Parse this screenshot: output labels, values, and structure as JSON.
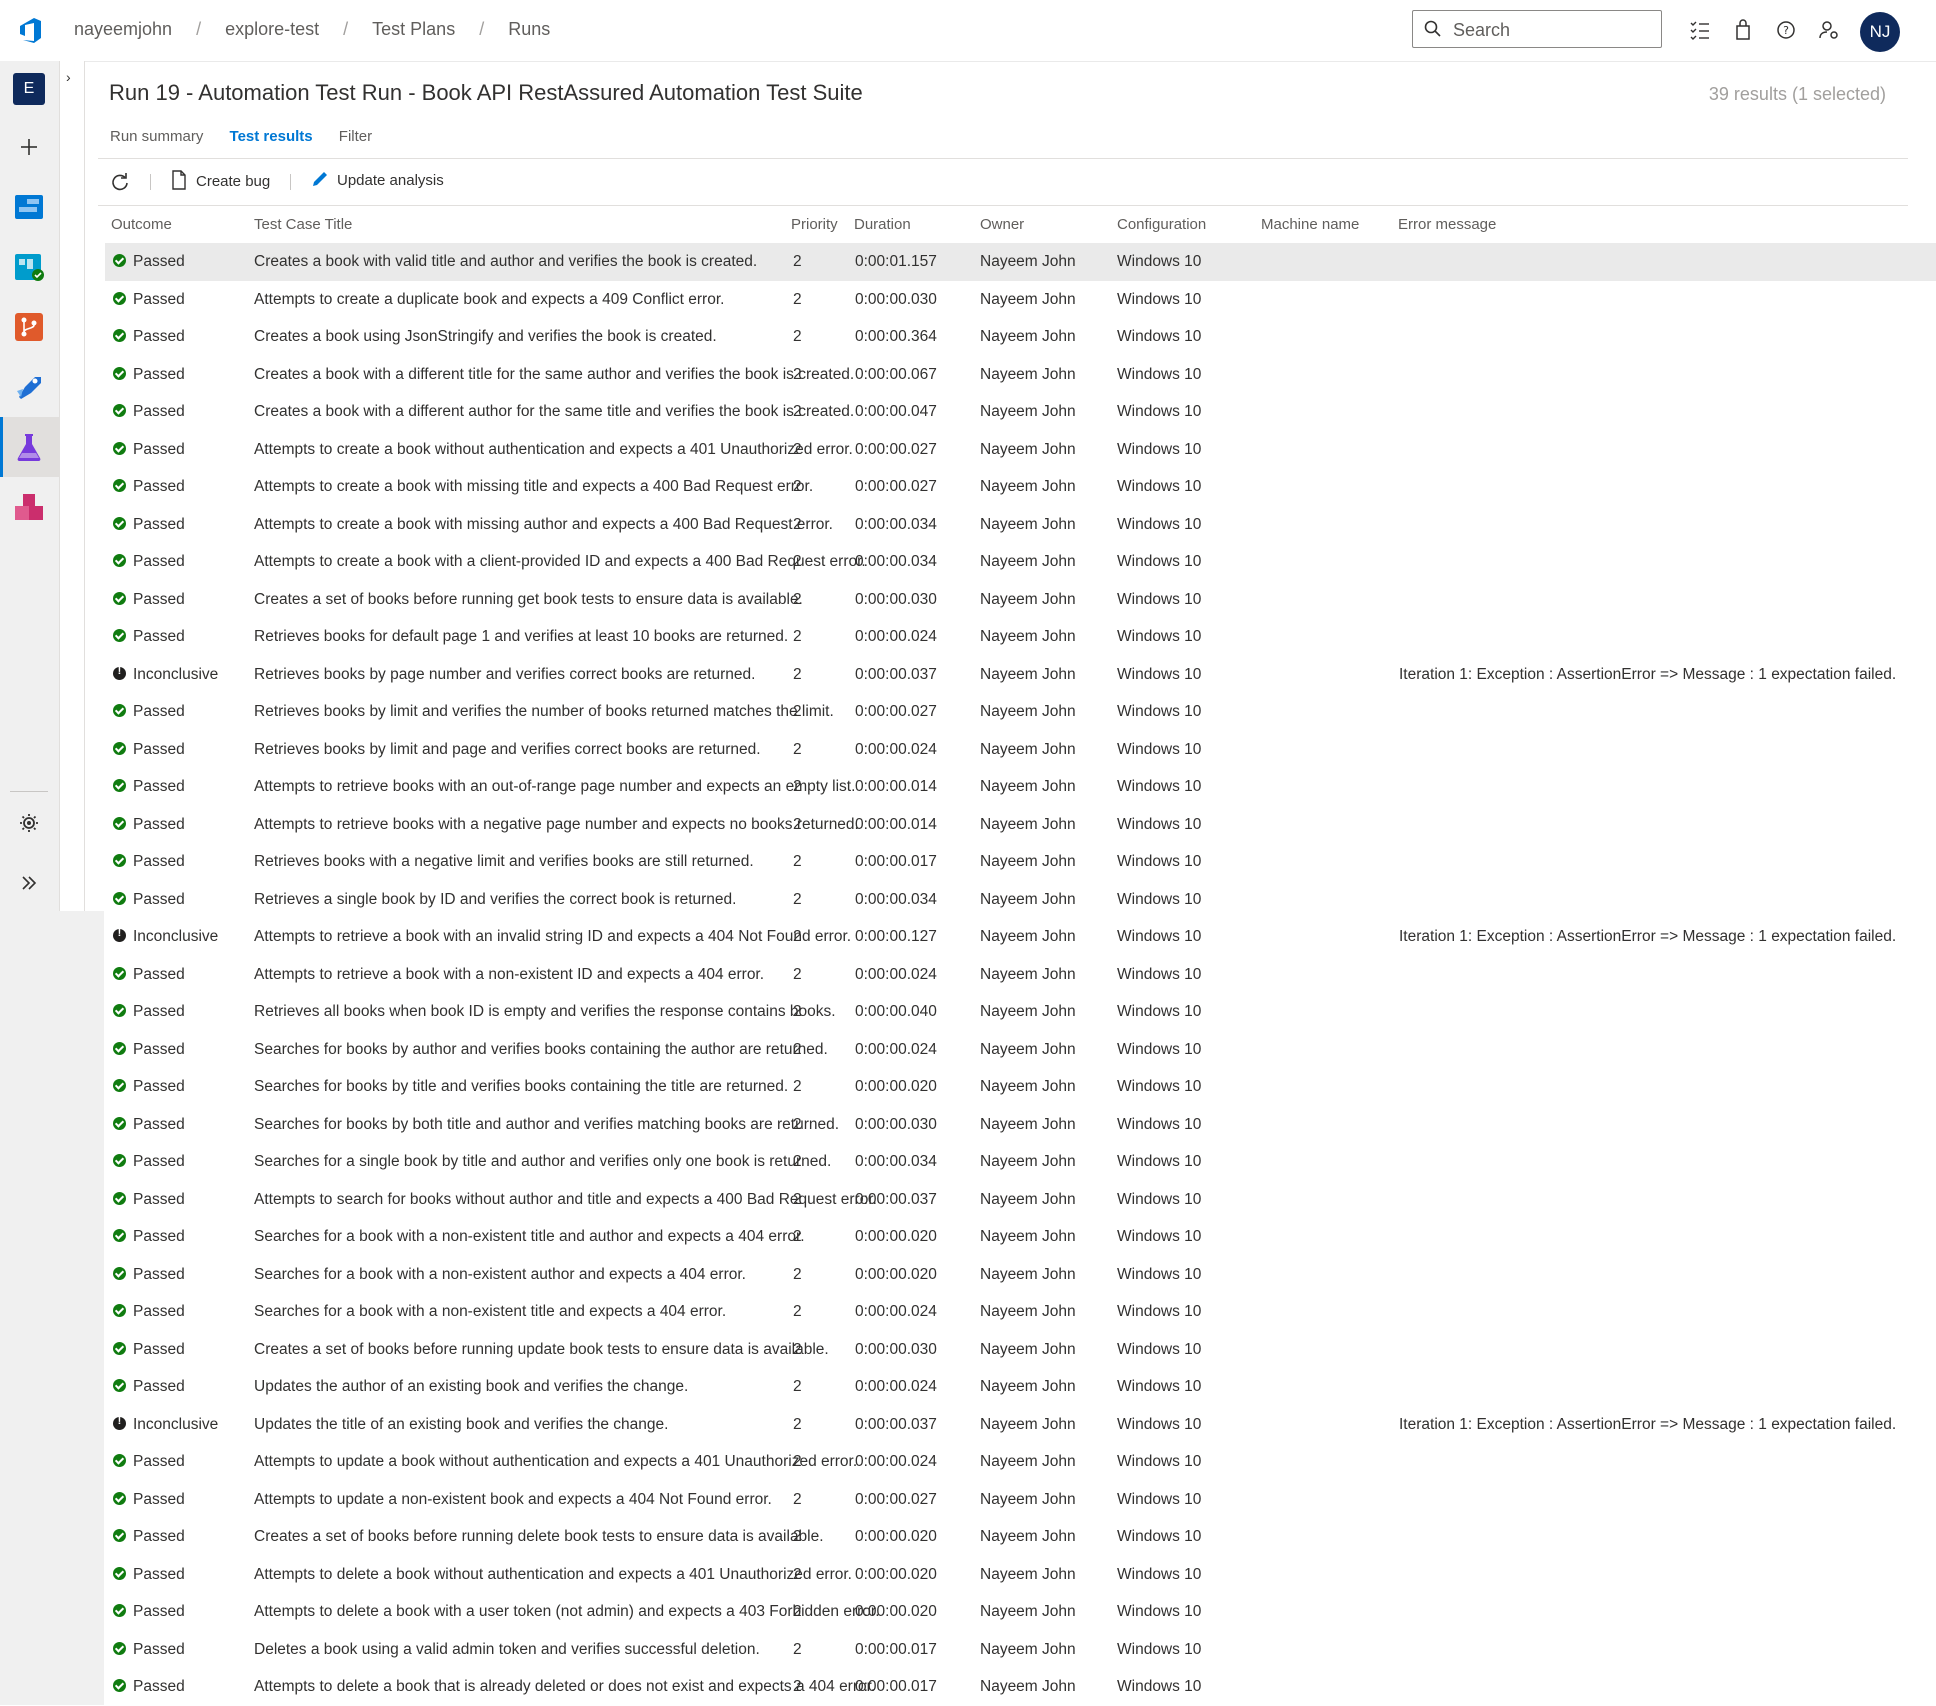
{
  "breadcrumb": [
    "nayeemjohn",
    "explore-test",
    "Test Plans",
    "Runs"
  ],
  "search": {
    "placeholder": "Search"
  },
  "user": {
    "initials": "NJ"
  },
  "rail": {
    "project_initial": "E"
  },
  "page": {
    "title": "Run 19 - Automation Test Run - Book API RestAssured Automation Test Suite",
    "result_count": "39 results (1 selected)"
  },
  "tabs": [
    {
      "label": "Run summary",
      "active": false
    },
    {
      "label": "Test results",
      "active": true
    },
    {
      "label": "Filter",
      "active": false
    }
  ],
  "toolbar": {
    "create_bug": "Create bug",
    "update_analysis": "Update analysis"
  },
  "columns": [
    "Outcome",
    "Test Case Title",
    "Priority",
    "Duration",
    "Owner",
    "Configuration",
    "Machine name",
    "Error message"
  ],
  "rows": [
    {
      "outcome": "Passed",
      "title": "Creates a book with valid title and author and verifies the book is created.",
      "priority": "2",
      "duration": "0:00:01.157",
      "owner": "Nayeem John",
      "config": "Windows 10",
      "machine": "",
      "error": ""
    },
    {
      "outcome": "Passed",
      "title": "Attempts to create a duplicate book and expects a 409 Conflict error.",
      "priority": "2",
      "duration": "0:00:00.030",
      "owner": "Nayeem John",
      "config": "Windows 10",
      "machine": "",
      "error": ""
    },
    {
      "outcome": "Passed",
      "title": "Creates a book using JsonStringify and verifies the book is created.",
      "priority": "2",
      "duration": "0:00:00.364",
      "owner": "Nayeem John",
      "config": "Windows 10",
      "machine": "",
      "error": ""
    },
    {
      "outcome": "Passed",
      "title": "Creates a book with a different title for the same author and verifies the book is created.",
      "priority": "2",
      "duration": "0:00:00.067",
      "owner": "Nayeem John",
      "config": "Windows 10",
      "machine": "",
      "error": ""
    },
    {
      "outcome": "Passed",
      "title": "Creates a book with a different author for the same title and verifies the book is created.",
      "priority": "2",
      "duration": "0:00:00.047",
      "owner": "Nayeem John",
      "config": "Windows 10",
      "machine": "",
      "error": ""
    },
    {
      "outcome": "Passed",
      "title": "Attempts to create a book without authentication and expects a 401 Unauthorized error.",
      "priority": "2",
      "duration": "0:00:00.027",
      "owner": "Nayeem John",
      "config": "Windows 10",
      "machine": "",
      "error": ""
    },
    {
      "outcome": "Passed",
      "title": "Attempts to create a book with missing title and expects a 400 Bad Request error.",
      "priority": "2",
      "duration": "0:00:00.027",
      "owner": "Nayeem John",
      "config": "Windows 10",
      "machine": "",
      "error": ""
    },
    {
      "outcome": "Passed",
      "title": "Attempts to create a book with missing author and expects a 400 Bad Request error.",
      "priority": "2",
      "duration": "0:00:00.034",
      "owner": "Nayeem John",
      "config": "Windows 10",
      "machine": "",
      "error": ""
    },
    {
      "outcome": "Passed",
      "title": "Attempts to create a book with a client-provided ID and expects a 400 Bad Request error.",
      "priority": "2",
      "duration": "0:00:00.034",
      "owner": "Nayeem John",
      "config": "Windows 10",
      "machine": "",
      "error": ""
    },
    {
      "outcome": "Passed",
      "title": "Creates a set of books before running get book tests to ensure data is available.",
      "priority": "2",
      "duration": "0:00:00.030",
      "owner": "Nayeem John",
      "config": "Windows 10",
      "machine": "",
      "error": ""
    },
    {
      "outcome": "Passed",
      "title": "Retrieves books for default page 1 and verifies at least 10 books are returned.",
      "priority": "2",
      "duration": "0:00:00.024",
      "owner": "Nayeem John",
      "config": "Windows 10",
      "machine": "",
      "error": ""
    },
    {
      "outcome": "Inconclusive",
      "title": "Retrieves books by page number and verifies correct books are returned.",
      "priority": "2",
      "duration": "0:00:00.037",
      "owner": "Nayeem John",
      "config": "Windows 10",
      "machine": "",
      "error": "Iteration 1: Exception : AssertionError => Message : 1 expectation failed.",
      "error_trunc": true
    },
    {
      "outcome": "Passed",
      "title": "Retrieves books by limit and verifies the number of books returned matches the limit.",
      "priority": "2",
      "duration": "0:00:00.027",
      "owner": "Nayeem John",
      "config": "Windows 10",
      "machine": "",
      "error": ""
    },
    {
      "outcome": "Passed",
      "title": "Retrieves books by limit and page and verifies correct books are returned.",
      "priority": "2",
      "duration": "0:00:00.024",
      "owner": "Nayeem John",
      "config": "Windows 10",
      "machine": "",
      "error": ""
    },
    {
      "outcome": "Passed",
      "title": "Attempts to retrieve books with an out-of-range page number and expects an empty list.",
      "priority": "2",
      "duration": "0:00:00.014",
      "owner": "Nayeem John",
      "config": "Windows 10",
      "machine": "",
      "error": ""
    },
    {
      "outcome": "Passed",
      "title": "Attempts to retrieve books with a negative page number and expects no books returned.",
      "priority": "2",
      "duration": "0:00:00.014",
      "owner": "Nayeem John",
      "config": "Windows 10",
      "machine": "",
      "error": ""
    },
    {
      "outcome": "Passed",
      "title": "Retrieves books with a negative limit and verifies books are still returned.",
      "priority": "2",
      "duration": "0:00:00.017",
      "owner": "Nayeem John",
      "config": "Windows 10",
      "machine": "",
      "error": ""
    },
    {
      "outcome": "Passed",
      "title": "Retrieves a single book by ID and verifies the correct book is returned.",
      "priority": "2",
      "duration": "0:00:00.034",
      "owner": "Nayeem John",
      "config": "Windows 10",
      "machine": "",
      "error": ""
    },
    {
      "outcome": "Inconclusive",
      "title": "Attempts to retrieve a book with an invalid string ID and expects a 404 Not Found error.",
      "priority": "2",
      "duration": "0:00:00.127",
      "owner": "Nayeem John",
      "config": "Windows 10",
      "machine": "",
      "error": "Iteration 1: Exception : AssertionError => Message : 1 expectation failed.",
      "error_trunc": true
    },
    {
      "outcome": "Passed",
      "title": "Attempts to retrieve a book with a non-existent ID and expects a 404 error.",
      "priority": "2",
      "duration": "0:00:00.024",
      "owner": "Nayeem John",
      "config": "Windows 10",
      "machine": "",
      "error": ""
    },
    {
      "outcome": "Passed",
      "title": "Retrieves all books when book ID is empty and verifies the response contains books.",
      "priority": "2",
      "duration": "0:00:00.040",
      "owner": "Nayeem John",
      "config": "Windows 10",
      "machine": "",
      "error": ""
    },
    {
      "outcome": "Passed",
      "title": "Searches for books by author and verifies books containing the author are returned.",
      "priority": "2",
      "duration": "0:00:00.024",
      "owner": "Nayeem John",
      "config": "Windows 10",
      "machine": "",
      "error": ""
    },
    {
      "outcome": "Passed",
      "title": "Searches for books by title and verifies books containing the title are returned.",
      "priority": "2",
      "duration": "0:00:00.020",
      "owner": "Nayeem John",
      "config": "Windows 10",
      "machine": "",
      "error": ""
    },
    {
      "outcome": "Passed",
      "title": "Searches for books by both title and author and verifies matching books are returned.",
      "priority": "2",
      "duration": "0:00:00.030",
      "owner": "Nayeem John",
      "config": "Windows 10",
      "machine": "",
      "error": ""
    },
    {
      "outcome": "Passed",
      "title": "Searches for a single book by title and author and verifies only one book is returned.",
      "priority": "2",
      "duration": "0:00:00.034",
      "owner": "Nayeem John",
      "config": "Windows 10",
      "machine": "",
      "error": ""
    },
    {
      "outcome": "Passed",
      "title": "Attempts to search for books without author and title and expects a 400 Bad Request error.",
      "priority": "2",
      "duration": "0:00:00.037",
      "owner": "Nayeem John",
      "config": "Windows 10",
      "machine": "",
      "error": ""
    },
    {
      "outcome": "Passed",
      "title": "Searches for a book with a non-existent title and author and expects a 404 error.",
      "priority": "2",
      "duration": "0:00:00.020",
      "owner": "Nayeem John",
      "config": "Windows 10",
      "machine": "",
      "error": ""
    },
    {
      "outcome": "Passed",
      "title": "Searches for a book with a non-existent author and expects a 404 error.",
      "priority": "2",
      "duration": "0:00:00.020",
      "owner": "Nayeem John",
      "config": "Windows 10",
      "machine": "",
      "error": ""
    },
    {
      "outcome": "Passed",
      "title": "Searches for a book with a non-existent title and expects a 404 error.",
      "priority": "2",
      "duration": "0:00:00.024",
      "owner": "Nayeem John",
      "config": "Windows 10",
      "machine": "",
      "error": ""
    },
    {
      "outcome": "Passed",
      "title": "Creates a set of books before running update book tests to ensure data is available.",
      "priority": "2",
      "duration": "0:00:00.030",
      "owner": "Nayeem John",
      "config": "Windows 10",
      "machine": "",
      "error": ""
    },
    {
      "outcome": "Passed",
      "title": "Updates the author of an existing book and verifies the change.",
      "priority": "2",
      "duration": "0:00:00.024",
      "owner": "Nayeem John",
      "config": "Windows 10",
      "machine": "",
      "error": ""
    },
    {
      "outcome": "Inconclusive",
      "title": "Updates the title of an existing book and verifies the change.",
      "priority": "2",
      "duration": "0:00:00.037",
      "owner": "Nayeem John",
      "config": "Windows 10",
      "machine": "",
      "error": "Iteration 1: Exception : AssertionError => Message : 1 expectation failed.",
      "error_trunc": true
    },
    {
      "outcome": "Passed",
      "title": "Attempts to update a book without authentication and expects a 401 Unauthorized error.",
      "priority": "2",
      "duration": "0:00:00.024",
      "owner": "Nayeem John",
      "config": "Windows 10",
      "machine": "",
      "error": ""
    },
    {
      "outcome": "Passed",
      "title": "Attempts to update a non-existent book and expects a 404 Not Found error.",
      "priority": "2",
      "duration": "0:00:00.027",
      "owner": "Nayeem John",
      "config": "Windows 10",
      "machine": "",
      "error": ""
    },
    {
      "outcome": "Passed",
      "title": "Creates a set of books before running delete book tests to ensure data is available.",
      "priority": "2",
      "duration": "0:00:00.020",
      "owner": "Nayeem John",
      "config": "Windows 10",
      "machine": "",
      "error": ""
    },
    {
      "outcome": "Passed",
      "title": "Attempts to delete a book without authentication and expects a 401 Unauthorized error.",
      "priority": "2",
      "duration": "0:00:00.020",
      "owner": "Nayeem John",
      "config": "Windows 10",
      "machine": "",
      "error": ""
    },
    {
      "outcome": "Passed",
      "title": "Attempts to delete a book with a user token (not admin) and expects a 403 Forbidden error.",
      "priority": "2",
      "duration": "0:00:00.020",
      "owner": "Nayeem John",
      "config": "Windows 10",
      "machine": "",
      "error": ""
    },
    {
      "outcome": "Passed",
      "title": "Deletes a book using a valid admin token and verifies successful deletion.",
      "priority": "2",
      "duration": "0:00:00.017",
      "owner": "Nayeem John",
      "config": "Windows 10",
      "machine": "",
      "error": ""
    },
    {
      "outcome": "Passed",
      "title": "Attempts to delete a book that is already deleted or does not exist and expects a 404 error.",
      "priority": "2",
      "duration": "0:00:00.017",
      "owner": "Nayeem John",
      "config": "Windows 10",
      "machine": "",
      "error": ""
    }
  ],
  "colors": {
    "accent": "#0078d4",
    "passed": "#107c10",
    "inconclusive": "#201f1e",
    "avatar": "#0f2a5c"
  }
}
